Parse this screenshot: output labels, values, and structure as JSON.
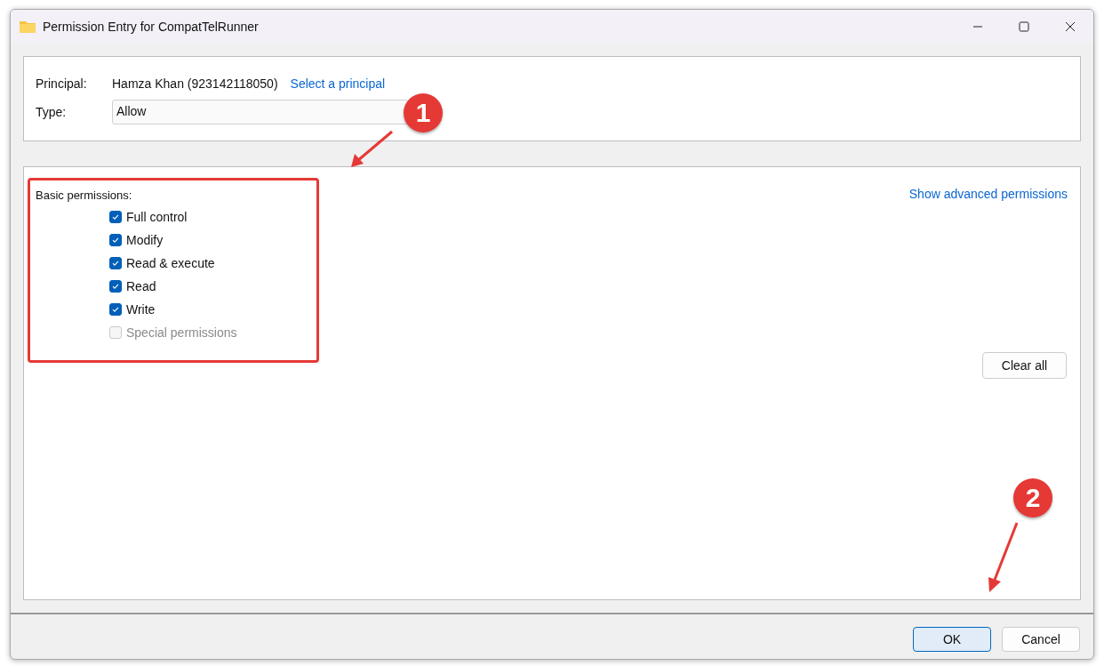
{
  "window": {
    "title": "Permission Entry for CompatTelRunner"
  },
  "principal": {
    "label": "Principal:",
    "value": "Hamza Khan (923142118050)",
    "link": "Select a principal"
  },
  "type": {
    "label": "Type:",
    "value": "Allow"
  },
  "permissions": {
    "heading": "Basic permissions:",
    "advanced_link": "Show advanced permissions",
    "clear_button": "Clear all",
    "items": [
      {
        "label": "Full control",
        "checked": true,
        "disabled": false
      },
      {
        "label": "Modify",
        "checked": true,
        "disabled": false
      },
      {
        "label": "Read & execute",
        "checked": true,
        "disabled": false
      },
      {
        "label": "Read",
        "checked": true,
        "disabled": false
      },
      {
        "label": "Write",
        "checked": true,
        "disabled": false
      },
      {
        "label": "Special permissions",
        "checked": false,
        "disabled": true
      }
    ]
  },
  "buttons": [
    {
      "label": "OK",
      "kind": "default"
    },
    {
      "label": "Cancel",
      "kind": "normal"
    }
  ],
  "annotations": [
    {
      "label": "1"
    },
    {
      "label": "2"
    }
  ]
}
